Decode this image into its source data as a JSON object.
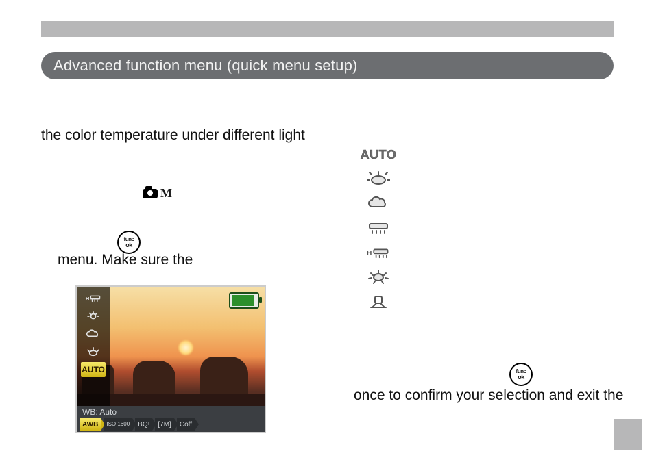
{
  "header": {
    "title": "Advanced function menu (quick menu setup)"
  },
  "body": {
    "line1": "the color temperature under different light",
    "line2": "menu.  Make sure the",
    "line3": "once to confirm your selection and exit the"
  },
  "icons": {
    "camera_mode_suffix": "M"
  },
  "func_ok": {
    "top": "func",
    "bottom": "ok"
  },
  "wb_options": {
    "auto_label": "AUTO",
    "items": [
      {
        "id": "auto",
        "name": "wb-auto"
      },
      {
        "id": "daylight",
        "name": "wb-daylight-icon"
      },
      {
        "id": "cloudy",
        "name": "wb-cloudy-icon"
      },
      {
        "id": "fluorescent",
        "name": "wb-fluorescent-icon"
      },
      {
        "id": "fluorescent-h",
        "name": "wb-fluorescent-h-icon"
      },
      {
        "id": "incandescent",
        "name": "wb-incandescent-icon"
      },
      {
        "id": "manual",
        "name": "wb-manual-icon"
      }
    ]
  },
  "lcd": {
    "selected_label": "AUTO",
    "wb_text": "WB: Auto",
    "left_rail": [
      {
        "id": "fluorescent-h",
        "name": "lcd-rail-fluorescent-h-icon"
      },
      {
        "id": "incandescent",
        "name": "lcd-rail-incandescent-icon"
      },
      {
        "id": "cloudy",
        "name": "lcd-rail-cloudy-icon"
      },
      {
        "id": "daylight",
        "name": "lcd-rail-daylight-icon"
      },
      {
        "id": "auto",
        "name": "lcd-rail-auto",
        "selected": true
      }
    ],
    "bottom_tabs": [
      {
        "label": "AWB",
        "name": "lcd-tab-awb",
        "active": true
      },
      {
        "label": "ISO 1600",
        "name": "lcd-tab-iso"
      },
      {
        "label": "BQ!",
        "name": "lcd-tab-bq"
      },
      {
        "label": "[7M]",
        "name": "lcd-tab-size"
      },
      {
        "label": "Coff",
        "name": "lcd-tab-coff"
      }
    ]
  }
}
